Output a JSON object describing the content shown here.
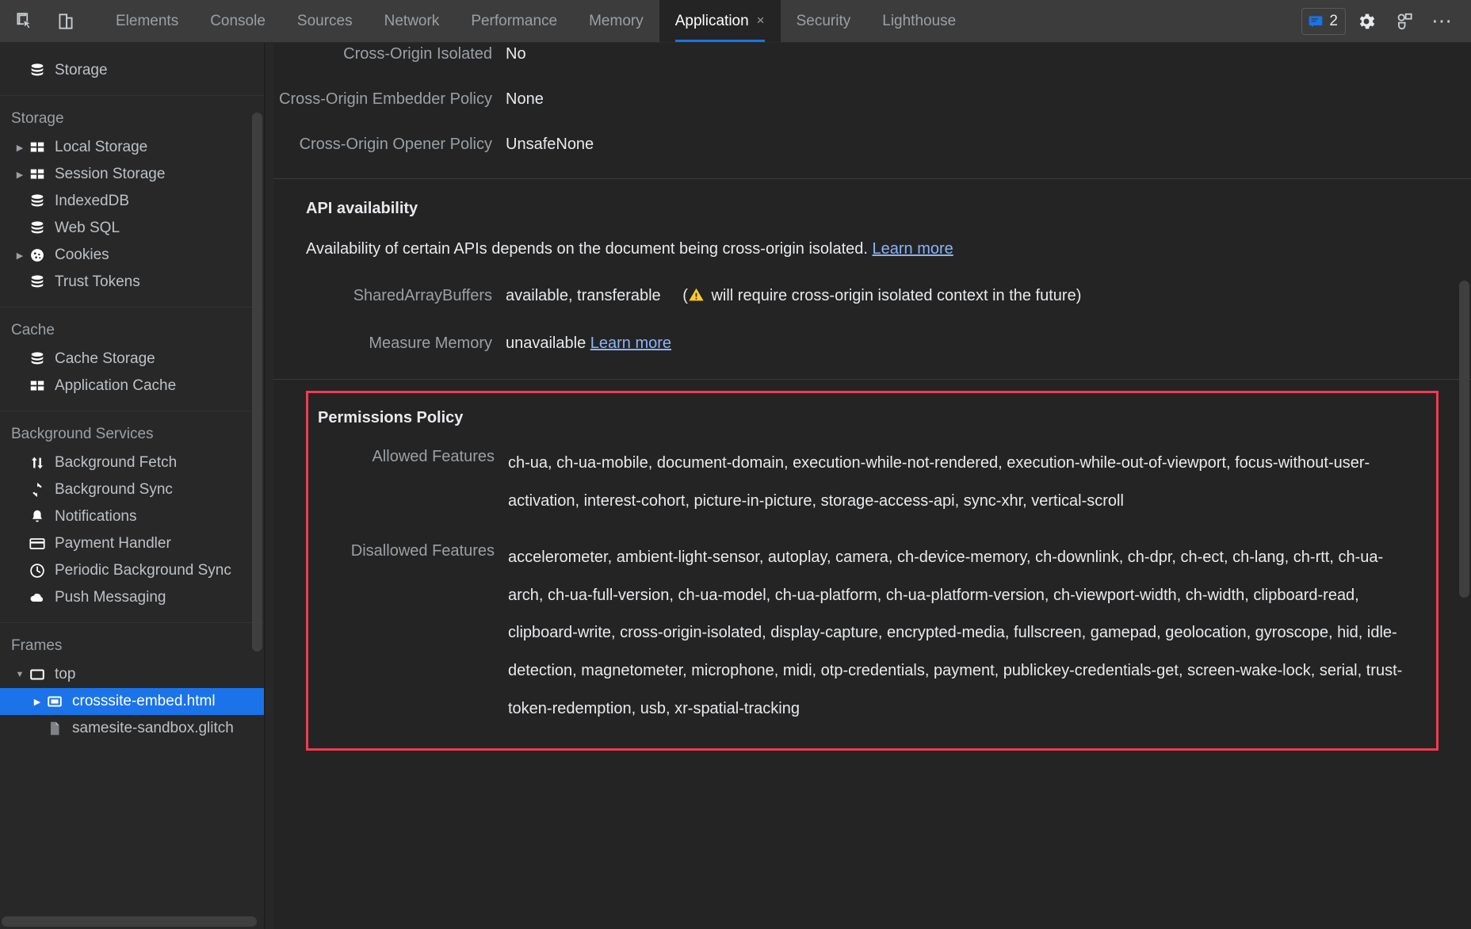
{
  "toolbar": {
    "left_icons": [
      {
        "name": "inspect-element-icon",
        "title": "Inspect element"
      },
      {
        "name": "device-toolbar-icon",
        "title": "Toggle device toolbar"
      }
    ],
    "tabs": [
      {
        "label": "Elements",
        "active": false,
        "closable": false
      },
      {
        "label": "Console",
        "active": false,
        "closable": false
      },
      {
        "label": "Sources",
        "active": false,
        "closable": false
      },
      {
        "label": "Network",
        "active": false,
        "closable": false
      },
      {
        "label": "Performance",
        "active": false,
        "closable": false
      },
      {
        "label": "Memory",
        "active": false,
        "closable": false
      },
      {
        "label": "Application",
        "active": true,
        "closable": true
      },
      {
        "label": "Security",
        "active": false,
        "closable": false
      },
      {
        "label": "Lighthouse",
        "active": false,
        "closable": false
      }
    ],
    "tab_close_glyph": "×",
    "issues_count": "2",
    "issues_icon": "issues-message-icon",
    "settings_icon": "gear-icon",
    "devices_icon": "devices-icon",
    "more_icon": "more-options-icon",
    "more_glyph": "⋯",
    "accent_color": "#1a73e8"
  },
  "sidebar": {
    "groups": [
      {
        "header": null,
        "items": [
          {
            "label": "Storage",
            "icon": "database-icon",
            "twisty": "none",
            "selected": false,
            "indent": 1
          }
        ]
      },
      {
        "header": "Storage",
        "items": [
          {
            "label": "Local Storage",
            "icon": "table-icon",
            "twisty": "collapsed",
            "selected": false,
            "indent": 1
          },
          {
            "label": "Session Storage",
            "icon": "table-icon",
            "twisty": "collapsed",
            "selected": false,
            "indent": 1
          },
          {
            "label": "IndexedDB",
            "icon": "database-icon",
            "twisty": "none",
            "selected": false,
            "indent": 1
          },
          {
            "label": "Web SQL",
            "icon": "database-icon",
            "twisty": "none",
            "selected": false,
            "indent": 1
          },
          {
            "label": "Cookies",
            "icon": "cookie-icon",
            "twisty": "collapsed",
            "selected": false,
            "indent": 1
          },
          {
            "label": "Trust Tokens",
            "icon": "database-icon",
            "twisty": "none",
            "selected": false,
            "indent": 1
          }
        ]
      },
      {
        "header": "Cache",
        "items": [
          {
            "label": "Cache Storage",
            "icon": "database-icon",
            "twisty": "none",
            "selected": false,
            "indent": 1
          },
          {
            "label": "Application Cache",
            "icon": "table-icon",
            "twisty": "none",
            "selected": false,
            "indent": 1
          }
        ]
      },
      {
        "header": "Background Services",
        "items": [
          {
            "label": "Background Fetch",
            "icon": "arrows-up-down-icon",
            "twisty": "none",
            "selected": false,
            "indent": 1
          },
          {
            "label": "Background Sync",
            "icon": "sync-icon",
            "twisty": "none",
            "selected": false,
            "indent": 1
          },
          {
            "label": "Notifications",
            "icon": "bell-icon",
            "twisty": "none",
            "selected": false,
            "indent": 1
          },
          {
            "label": "Payment Handler",
            "icon": "credit-card-icon",
            "twisty": "none",
            "selected": false,
            "indent": 1
          },
          {
            "label": "Periodic Background Sync",
            "icon": "clock-icon",
            "twisty": "none",
            "selected": false,
            "indent": 1
          },
          {
            "label": "Push Messaging",
            "icon": "cloud-icon",
            "twisty": "none",
            "selected": false,
            "indent": 1
          }
        ]
      },
      {
        "header": "Frames",
        "items": [
          {
            "label": "top",
            "icon": "frame-icon",
            "twisty": "expanded",
            "selected": false,
            "indent": 1
          },
          {
            "label": "crosssite-embed.html",
            "icon": "iframe-icon",
            "twisty": "collapsed",
            "selected": true,
            "indent": 2
          },
          {
            "label": "samesite-sandbox.glitch",
            "icon": "document-icon",
            "twisty": "none",
            "selected": false,
            "indent": 2
          }
        ]
      }
    ],
    "selected_bg": "#1a73e8"
  },
  "main": {
    "security_rows": [
      {
        "key": "Cross-Origin Isolated",
        "value": "No"
      },
      {
        "key": "Cross-Origin Embedder Policy",
        "value": "None"
      },
      {
        "key": "Cross-Origin Opener Policy",
        "value": "UnsafeNone"
      }
    ],
    "api_availability": {
      "title": "API availability",
      "description": "Availability of certain APIs depends on the document being cross-origin isolated.",
      "description_link": "Learn more",
      "rows": [
        {
          "key": "SharedArrayBuffers",
          "value": "available, transferable",
          "note_prefix": "(",
          "note_icon": "warning-triangle-icon",
          "note": " will require cross-origin isolated context in the future)",
          "link": null
        },
        {
          "key": "Measure Memory",
          "value": "unavailable",
          "note_prefix": "",
          "note_icon": null,
          "note": "",
          "link": "Learn more"
        }
      ]
    },
    "permissions_policy": {
      "title": "Permissions Policy",
      "highlight_color": "#f23a52",
      "allowed_label": "Allowed Features",
      "allowed_features": "ch-ua, ch-ua-mobile, document-domain, execution-while-not-rendered, execution-while-out-of-viewport, focus-without-user-activation, interest-cohort, picture-in-picture, storage-access-api, sync-xhr, vertical-scroll",
      "disallowed_label": "Disallowed Features",
      "disallowed_features": "accelerometer, ambient-light-sensor, autoplay, camera, ch-device-memory, ch-downlink, ch-dpr, ch-ect, ch-lang, ch-rtt, ch-ua-arch, ch-ua-full-version, ch-ua-model, ch-ua-platform, ch-ua-platform-version, ch-viewport-width, ch-width, clipboard-read, clipboard-write, cross-origin-isolated, display-capture, encrypted-media, fullscreen, gamepad, geolocation, gyroscope, hid, idle-detection, magnetometer, microphone, midi, otp-credentials, payment, publickey-credentials-get, screen-wake-lock, serial, trust-token-redemption, usb, xr-spatial-tracking"
    }
  }
}
